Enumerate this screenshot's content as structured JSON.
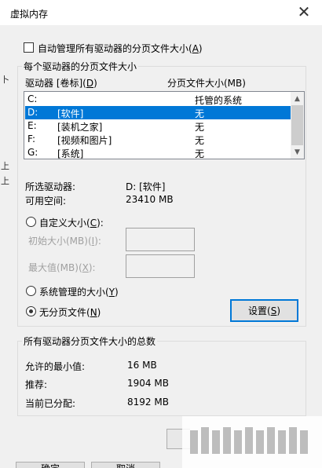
{
  "dialog": {
    "title": "虚拟内存",
    "close_glyph": "✕"
  },
  "auto_manage": {
    "label_pre": "自动管理所有驱动器的分页文件大小(",
    "label_key": "A",
    "label_post": ")",
    "checked": false
  },
  "drives_group": {
    "title": "每个驱动器的分页文件大小",
    "col_drive_pre": "驱动器 [卷标](",
    "col_drive_key": "D",
    "col_drive_post": ")",
    "col_size": "分页文件大小(MB)",
    "rows": [
      {
        "letter": "C:",
        "label": "",
        "size": "托管的系统"
      },
      {
        "letter": "D:",
        "label": "[软件]",
        "size": "无"
      },
      {
        "letter": "E:",
        "label": "[装机之家]",
        "size": "无"
      },
      {
        "letter": "F:",
        "label": "[视频和图片]",
        "size": "无"
      },
      {
        "letter": "G:",
        "label": "[系统]",
        "size": "无"
      }
    ],
    "selected_index": 1,
    "selected_drive_label": "所选驱动器:",
    "selected_drive_value": "D:  [软件]",
    "free_space_label": "可用空间:",
    "free_space_value": "23410 MB",
    "custom_size_pre": "自定义大小(",
    "custom_size_key": "C",
    "custom_size_post": "):",
    "initial_size_pre": "初始大小(MB)(",
    "initial_size_key": "I",
    "initial_size_post": "):",
    "max_size_pre": "最大值(MB)(",
    "max_size_key": "X",
    "max_size_post": "):",
    "system_managed_pre": "系统管理的大小(",
    "system_managed_key": "Y",
    "system_managed_post": ")",
    "no_paging_pre": "无分页文件(",
    "no_paging_key": "N",
    "no_paging_post": ")",
    "set_button_pre": "设置(",
    "set_button_key": "S",
    "set_button_post": ")",
    "selected_option": "no_paging"
  },
  "totals_group": {
    "title": "所有驱动器分页文件大小的总数",
    "min_label": "允许的最小值:",
    "min_value": "16 MB",
    "recommended_label": "推荐:",
    "recommended_value": "1904 MB",
    "current_label": "当前已分配:",
    "current_value": "8192 MB"
  },
  "footer": {
    "ok_partial": "确定",
    "cancel_partial": "取消"
  },
  "background_window": {
    "frag_1": "卜",
    "frag_2": "上",
    "frag_3": "上"
  }
}
